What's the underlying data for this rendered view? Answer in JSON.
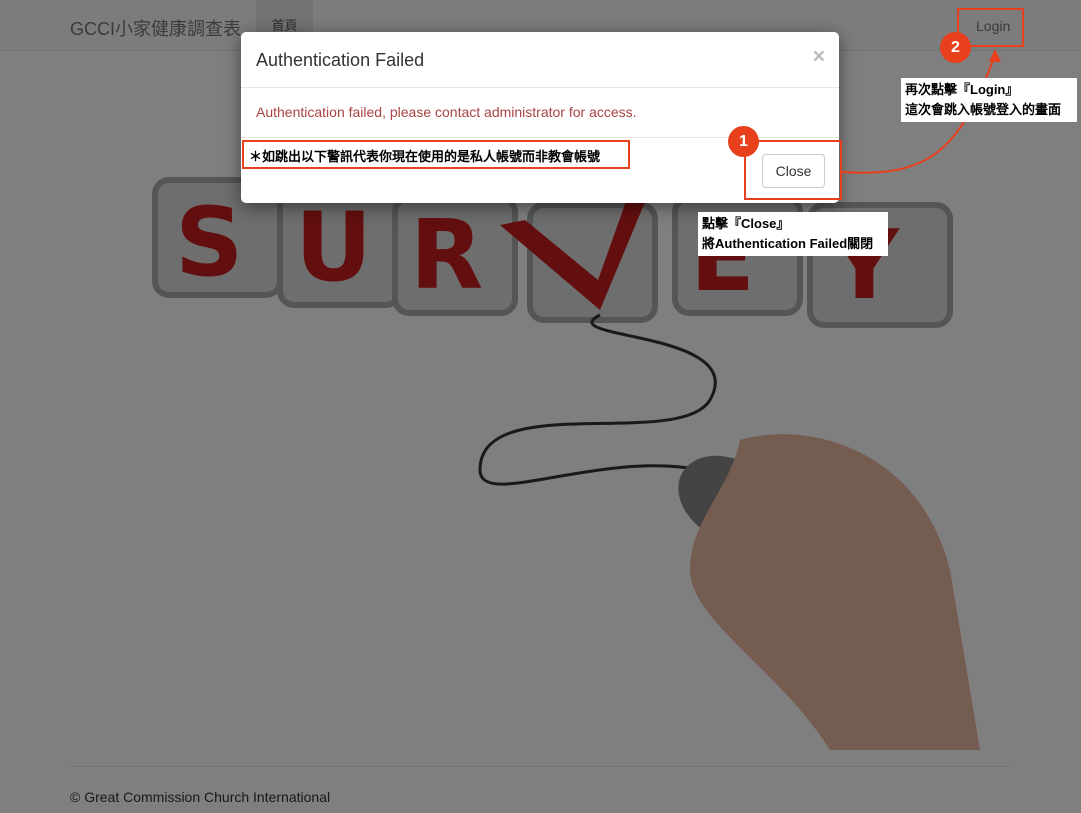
{
  "navbar": {
    "brand": "GCCI小家健康調查表",
    "home": "首頁",
    "login": "Login"
  },
  "hero": {
    "word": "SURVEY"
  },
  "footer": {
    "text": "© Great Commission Church International"
  },
  "modal": {
    "title": "Authentication Failed",
    "close_x": "×",
    "message": "Authentication failed, please contact administrator for access.",
    "close_button": "Close"
  },
  "annotations": {
    "warning": "＊如跳出以下警訊代表你現在使用的是私人帳號而非教會帳號",
    "step1": "1",
    "step1_line1": "點擊『Close』",
    "step1_line2": "將Authentication Failed關閉",
    "step2": "2",
    "step2_line1": "再次點擊『Login』",
    "step2_line2": "這次會跳入帳號登入的畫面"
  },
  "colors": {
    "annotation": "#e8401c",
    "error_text": "#a94442"
  }
}
